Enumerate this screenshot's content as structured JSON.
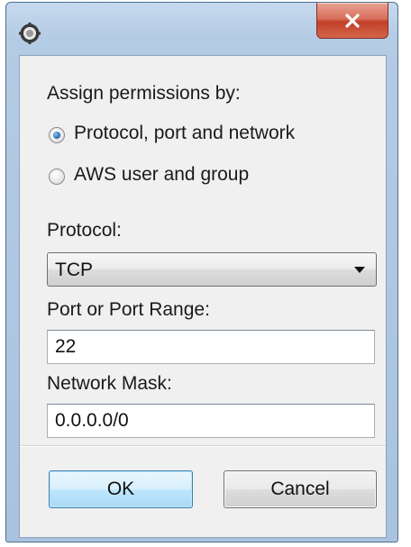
{
  "window": {
    "title": ""
  },
  "titlebar": {
    "app_icon": "gear-icon",
    "close_icon": "close-icon",
    "close_label": "x"
  },
  "form": {
    "assign_label": "Assign permissions by:",
    "options": [
      {
        "label": "Protocol, port and network",
        "checked": true
      },
      {
        "label": "AWS user and group",
        "checked": false
      }
    ],
    "protocol_label": "Protocol:",
    "protocol_value": "TCP",
    "port_label": "Port or Port Range:",
    "port_value": "22",
    "mask_label": "Network Mask:",
    "mask_value": "0.0.0.0/0"
  },
  "buttons": {
    "ok_label": "OK",
    "cancel_label": "Cancel"
  },
  "colors": {
    "close_button": "#c23f27",
    "ok_button_border": "#3c7fb1",
    "radio_checked": "#2b6fb6"
  }
}
